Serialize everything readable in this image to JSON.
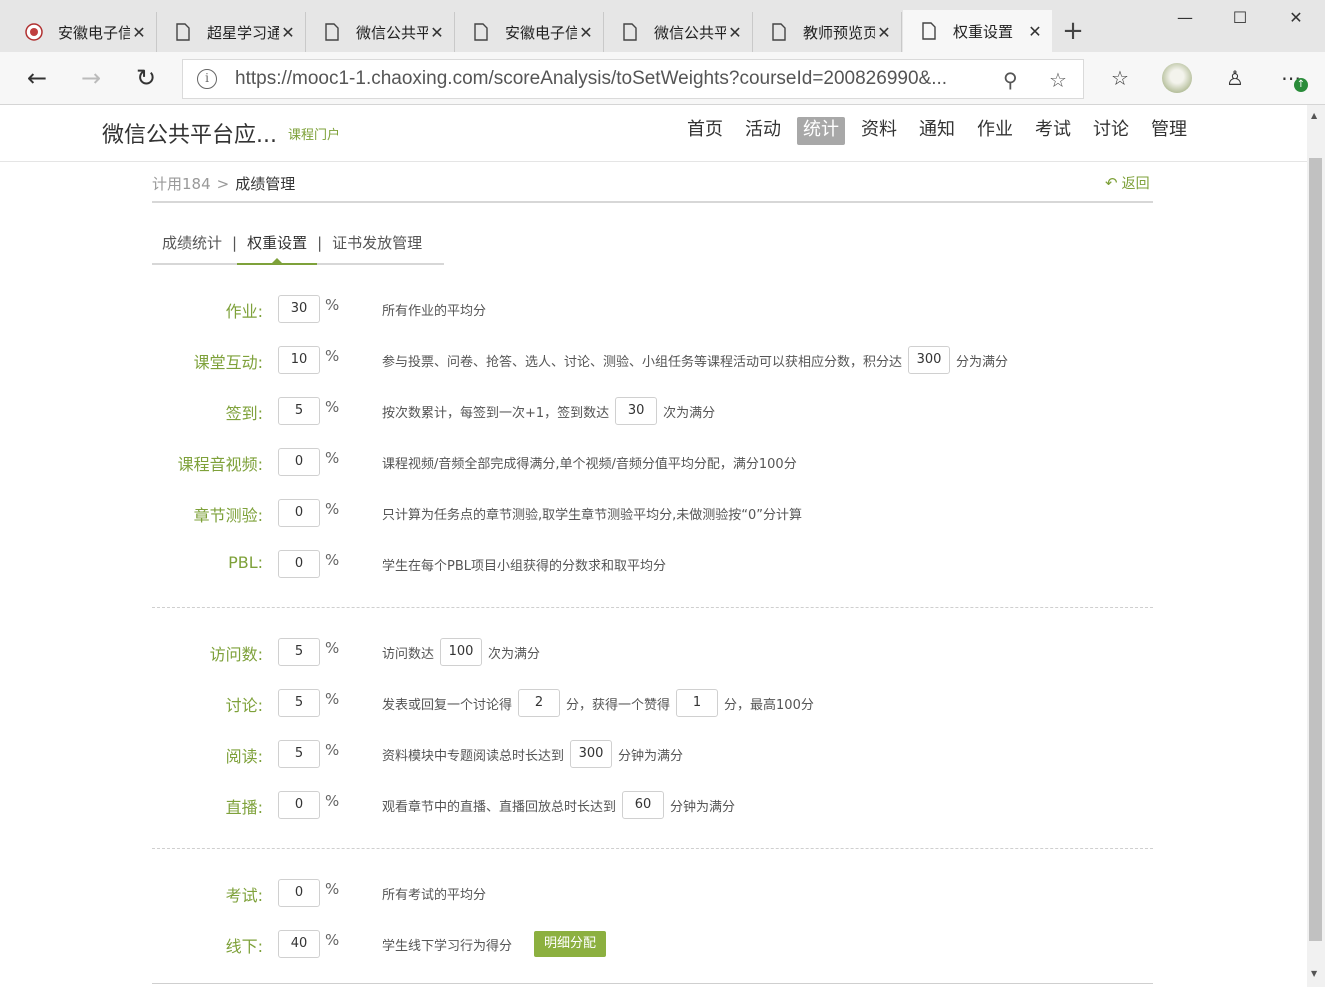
{
  "browser": {
    "tabs": [
      {
        "title": "安徽电子信",
        "icon": "school-logo-icon"
      },
      {
        "title": "超星学习通",
        "icon": "page-icon"
      },
      {
        "title": "微信公共平",
        "icon": "page-icon"
      },
      {
        "title": "安徽电子信",
        "icon": "page-icon"
      },
      {
        "title": "微信公共平",
        "icon": "page-icon"
      },
      {
        "title": "教师预览页",
        "icon": "page-icon"
      },
      {
        "title": "权重设置",
        "icon": "page-icon",
        "active": true
      }
    ],
    "url": "https://mooc1-1.chaoxing.com/scoreAnalysis/toSetWeights?courseId=200826990&..."
  },
  "site": {
    "course_title": "微信公共平台应...",
    "portal_link": "课程门户",
    "nav": [
      "首页",
      "活动",
      "统计",
      "资料",
      "通知",
      "作业",
      "考试",
      "讨论",
      "管理"
    ],
    "nav_active": "统计"
  },
  "breadcrumb": {
    "class": "计用184",
    "separator": ">",
    "current": "成绩管理"
  },
  "back_label": "返回",
  "subtabs": [
    "成绩统计",
    "权重设置",
    "证书发放管理"
  ],
  "pct_sign": "%",
  "weights": {
    "homework": {
      "label": "作业:",
      "value": "30",
      "desc": "所有作业的平均分"
    },
    "interaction": {
      "label": "课堂互动:",
      "value": "10",
      "desc_a": "参与投票、问卷、抢答、选人、讨论、测验、小组任务等课程活动可以获相应分数，积分达",
      "threshold": "300",
      "desc_b": "分为满分"
    },
    "signin": {
      "label": "签到:",
      "value": "5",
      "desc_a": "按次数累计，每签到一次+1，签到数达",
      "threshold": "30",
      "desc_b": "次为满分"
    },
    "video": {
      "label": "课程音视频:",
      "value": "0",
      "desc": "课程视频/音频全部完成得满分,单个视频/音频分值平均分配，满分100分"
    },
    "chapter_quiz": {
      "label": "章节测验:",
      "value": "0",
      "desc": "只计算为任务点的章节测验,取学生章节测验平均分,未做测验按“0”分计算"
    },
    "pbl": {
      "label": "PBL:",
      "value": "0",
      "desc": "学生在每个PBL项目小组获得的分数求和取平均分"
    },
    "visits": {
      "label": "访问数:",
      "value": "5",
      "desc_a": "访问数达",
      "threshold": "100",
      "desc_b": "次为满分"
    },
    "discussion": {
      "label": "讨论:",
      "value": "5",
      "desc_a": "发表或回复一个讨论得",
      "per_post": "2",
      "desc_b": "分，获得一个赞得",
      "per_like": "1",
      "desc_c": "分，最高100分"
    },
    "reading": {
      "label": "阅读:",
      "value": "5",
      "desc_a": "资料模块中专题阅读总时长达到",
      "threshold": "300",
      "desc_b": "分钟为满分"
    },
    "live": {
      "label": "直播:",
      "value": "0",
      "desc_a": "观看章节中的直播、直播回放总时长达到",
      "threshold": "60",
      "desc_b": "分钟为满分"
    },
    "exam": {
      "label": "考试:",
      "value": "0",
      "desc": "所有考试的平均分"
    },
    "offline": {
      "label": "线下:",
      "value": "40",
      "desc": "学生线下学习行为得分",
      "button": "明细分配"
    }
  }
}
